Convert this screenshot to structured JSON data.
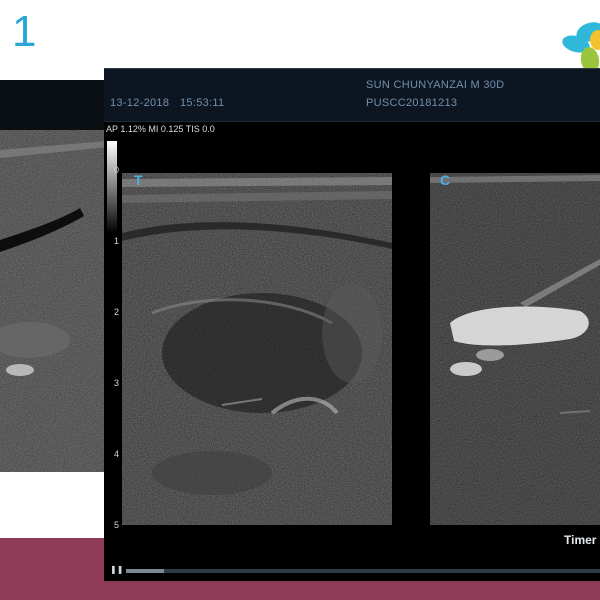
{
  "slide": {
    "number": "1"
  },
  "header": {
    "date": "13-12-2018",
    "time": "15:53:11",
    "patient": "SUN CHUNYANZAI M 30D",
    "exam_id": "PUSCC20181213"
  },
  "params": "AP 1.12%  MI 0.125 TIS 0.0",
  "depth_scale": {
    "ticks": [
      "0",
      "1",
      "2",
      "3",
      "4",
      "5"
    ]
  },
  "images": {
    "left_label": "T",
    "right_label": "C"
  },
  "timer_label": "Timer",
  "playback": {
    "progress": 0.08
  },
  "icons": {
    "play": "pause-icon",
    "logo": "brand-logo-icon"
  },
  "colors": {
    "accent": "#2aa6d6",
    "band": "#8f3a57",
    "header_text": "#6f8fb0"
  }
}
